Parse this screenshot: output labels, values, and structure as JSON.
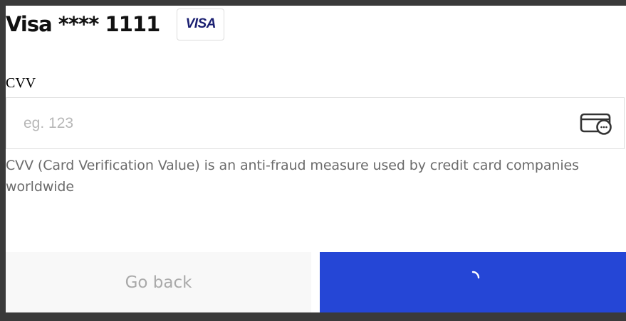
{
  "card": {
    "title": "Visa **** 1111",
    "brand": "VISA",
    "brand_icon": "visa-logo-icon"
  },
  "cvv": {
    "label": "CVV",
    "placeholder": "eg. 123",
    "value": "",
    "icon": "card-cvv-icon",
    "help": "CVV (Card Verification Value) is an anti-fraud measure used by credit card companies worldwide"
  },
  "actions": {
    "back_label": "Go back",
    "submit_state": "loading",
    "submit_icon": "loading-spinner-icon"
  },
  "colors": {
    "primary": "#2546d6",
    "brand": "#1a1f71",
    "muted_text": "#6b6b6b",
    "placeholder": "#b7b7b7",
    "back_button_bg": "#f8f8f8",
    "back_button_text": "#a9a9a9"
  }
}
